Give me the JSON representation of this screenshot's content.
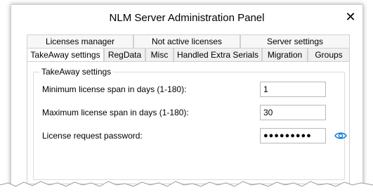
{
  "window": {
    "title": "NLM Server Administration Panel",
    "close_label": "✕"
  },
  "tabs_back": [
    {
      "label": "Licenses manager"
    },
    {
      "label": "Not active licenses"
    },
    {
      "label": "Server settings"
    }
  ],
  "tabs_front": [
    {
      "label": "TakeAway settings",
      "active": true
    },
    {
      "label": "RegData"
    },
    {
      "label": "Misc"
    },
    {
      "label": "Handled Extra Serials"
    },
    {
      "label": "Migration"
    },
    {
      "label": "Groups"
    }
  ],
  "takeaway": {
    "group_title": "TakeAway settings",
    "min_label": "Minimum license span in days (1-180):",
    "min_value": "1",
    "max_label": "Maximum license span in days (1-180):",
    "max_value": "30",
    "pwd_label": "License request password:",
    "pwd_mask": "●●●●●●●●●"
  },
  "colors": {
    "accent": "#0a78d4",
    "border": "#d0d0d0"
  },
  "icons": {
    "reveal": "eye-icon",
    "close": "close-icon"
  }
}
